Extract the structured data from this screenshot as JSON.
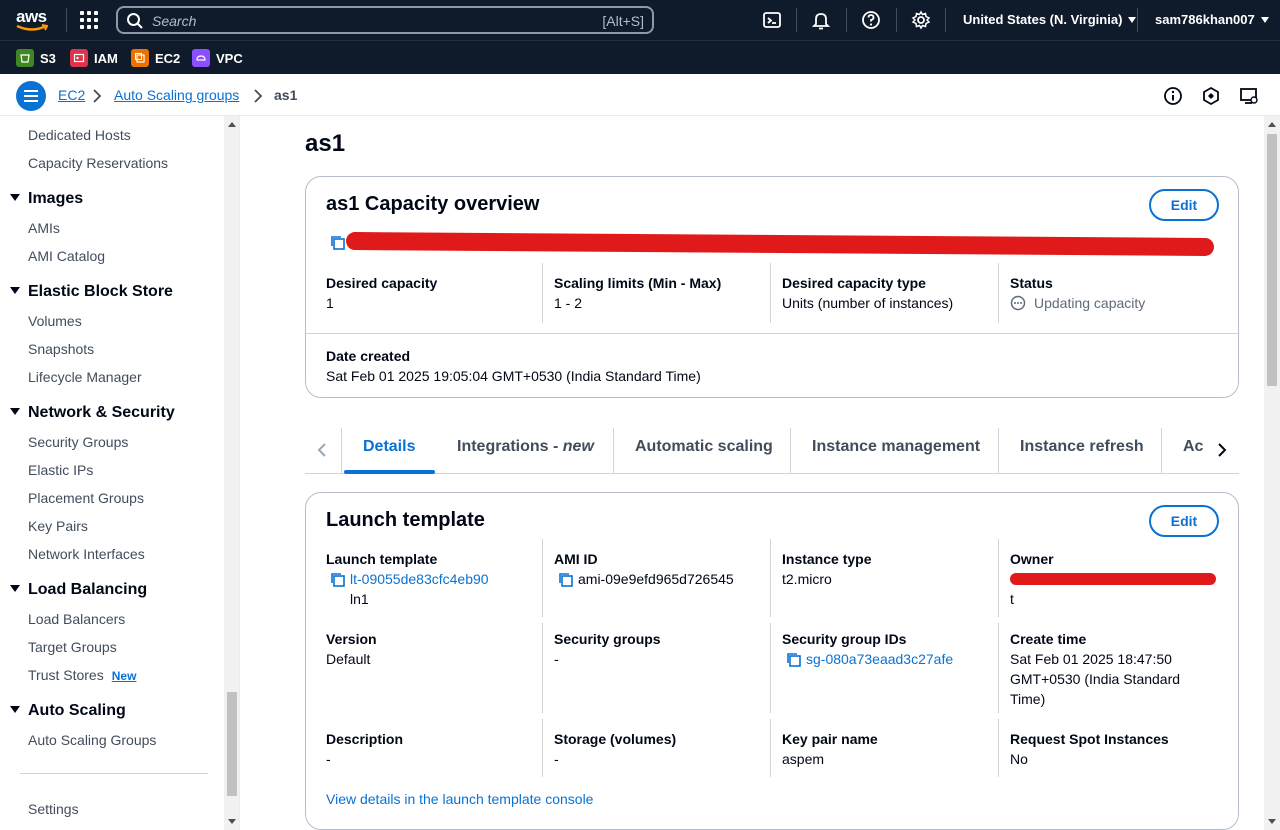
{
  "topbar": {
    "logo": "aws",
    "search_placeholder": "Search",
    "search_shortcut": "[Alt+S]",
    "region": "United States (N. Virginia)",
    "user": "sam786khan007"
  },
  "favorites": [
    {
      "label": "S3",
      "color": "#3f8624"
    },
    {
      "label": "IAM",
      "color": "#dd344c"
    },
    {
      "label": "EC2",
      "color": "#ed7100"
    },
    {
      "label": "VPC",
      "color": "#8c4fff"
    }
  ],
  "breadcrumb": {
    "items": [
      "EC2",
      "Auto Scaling groups",
      "as1"
    ]
  },
  "sidebar": {
    "items_top": [
      "Dedicated Hosts",
      "Capacity Reservations"
    ],
    "images": {
      "title": "Images",
      "items": [
        "AMIs",
        "AMI Catalog"
      ]
    },
    "ebs": {
      "title": "Elastic Block Store",
      "items": [
        "Volumes",
        "Snapshots",
        "Lifecycle Manager"
      ]
    },
    "network": {
      "title": "Network & Security",
      "items": [
        "Security Groups",
        "Elastic IPs",
        "Placement Groups",
        "Key Pairs",
        "Network Interfaces"
      ]
    },
    "lb": {
      "title": "Load Balancing",
      "items": [
        "Load Balancers",
        "Target Groups",
        "Trust Stores"
      ],
      "new_badge": "New"
    },
    "asg": {
      "title": "Auto Scaling",
      "items": [
        "Auto Scaling Groups"
      ]
    },
    "settings": "Settings"
  },
  "page": {
    "title": "as1"
  },
  "capacity": {
    "title": "as1 Capacity overview",
    "edit": "Edit",
    "desired_label": "Desired capacity",
    "desired_value": "1",
    "limits_label": "Scaling limits (Min - Max)",
    "limits_value": "1 - 2",
    "type_label": "Desired capacity type",
    "type_value": "Units (number of instances)",
    "status_label": "Status",
    "status_value": "Updating capacity",
    "date_label": "Date created",
    "date_value": "Sat Feb 01 2025 19:05:04 GMT+0530 (India Standard Time)"
  },
  "tabs": [
    "Details",
    "Integrations - ",
    "new",
    "Automatic scaling",
    "Instance management",
    "Instance refresh",
    "Ac"
  ],
  "launch": {
    "title": "Launch template",
    "edit": "Edit",
    "lt_label": "Launch template",
    "lt_id": "lt-09055de83cfc4eb90",
    "lt_name": "ln1",
    "ami_label": "AMI ID",
    "ami_value": "ami-09e9efd965d726545",
    "itype_label": "Instance type",
    "itype_value": "t2.micro",
    "owner_label": "Owner",
    "owner_tail": "t",
    "version_label": "Version",
    "version_value": "Default",
    "sg_label": "Security groups",
    "sg_value": "-",
    "sgid_label": "Security group IDs",
    "sgid_value": "sg-080a73eaad3c27afe",
    "ctime_label": "Create time",
    "ctime_line1": "Sat Feb 01 2025 18:47:50",
    "ctime_line2": "GMT+0530 (India Standard",
    "ctime_line3": "Time)",
    "desc_label": "Description",
    "desc_value": "-",
    "storage_label": "Storage (volumes)",
    "storage_value": "-",
    "key_label": "Key pair name",
    "key_value": "aspem",
    "spot_label": "Request Spot Instances",
    "spot_value": "No",
    "view_link": "View details in the launch template console"
  }
}
